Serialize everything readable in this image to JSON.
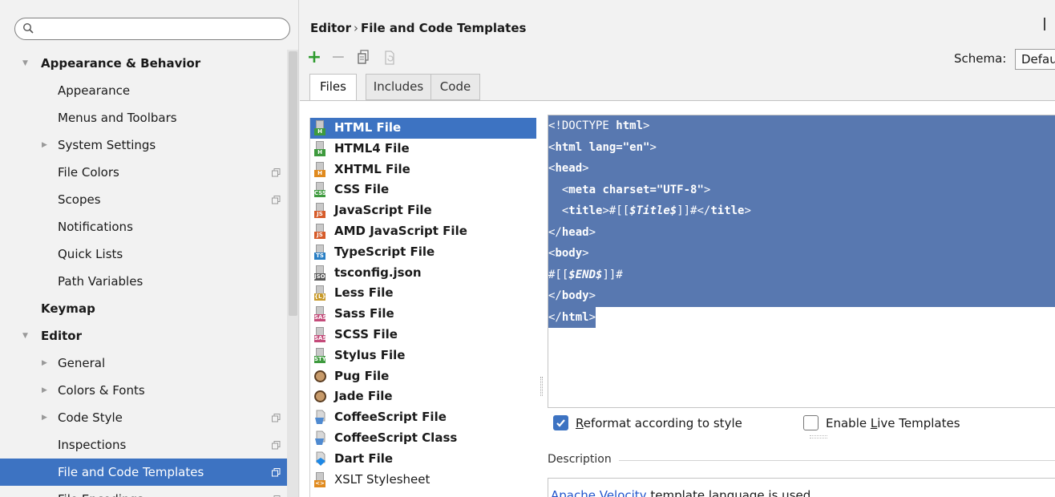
{
  "search": {
    "placeholder": ""
  },
  "tree": [
    {
      "label": "Appearance & Behavior",
      "level": 0,
      "expanded": true
    },
    {
      "label": "Appearance",
      "level": 1
    },
    {
      "label": "Menus and Toolbars",
      "level": 1
    },
    {
      "label": "System Settings",
      "level": 1,
      "collapsed": true
    },
    {
      "label": "File Colors",
      "level": 1,
      "copy": true
    },
    {
      "label": "Scopes",
      "level": 1,
      "copy": true
    },
    {
      "label": "Notifications",
      "level": 1
    },
    {
      "label": "Quick Lists",
      "level": 1
    },
    {
      "label": "Path Variables",
      "level": 1
    },
    {
      "label": "Keymap",
      "level": 0
    },
    {
      "label": "Editor",
      "level": 0,
      "expanded": true
    },
    {
      "label": "General",
      "level": 1,
      "collapsed": true
    },
    {
      "label": "Colors & Fonts",
      "level": 1,
      "collapsed": true
    },
    {
      "label": "Code Style",
      "level": 1,
      "collapsed": true,
      "copy": true
    },
    {
      "label": "Inspections",
      "level": 1,
      "copy": true
    },
    {
      "label": "File and Code Templates",
      "level": 1,
      "copy": true,
      "selected": true
    },
    {
      "label": "File Encodings",
      "level": 1,
      "copy": true
    }
  ],
  "header": {
    "crumb_parent": "Editor",
    "crumb_sep": "›",
    "crumb_current": "File and Code Templates"
  },
  "toolbar": {
    "add": "+",
    "remove": "−"
  },
  "schema": {
    "label": "Schema:",
    "value": "Defau"
  },
  "tabs": [
    "Files",
    "Includes",
    "Code"
  ],
  "templates": [
    {
      "name": "HTML File",
      "tag": "H",
      "color": "#3e9a3e",
      "selected": true
    },
    {
      "name": "HTML4 File",
      "tag": "H",
      "color": "#3e9a3e"
    },
    {
      "name": "XHTML File",
      "tag": "H",
      "color": "#e08a1e"
    },
    {
      "name": "CSS File",
      "tag": "CSS",
      "color": "#3e9a3e"
    },
    {
      "name": "JavaScript File",
      "tag": "JS",
      "color": "#d65c2a"
    },
    {
      "name": "AMD JavaScript File",
      "tag": "JS",
      "color": "#d65c2a"
    },
    {
      "name": "TypeScript File",
      "tag": "TS",
      "color": "#2a7fc4"
    },
    {
      "name": "tsconfig.json",
      "tag": "JSON",
      "color": "#555555"
    },
    {
      "name": "Less File",
      "tag": "{L}",
      "color": "#c89a2a"
    },
    {
      "name": "Sass File",
      "tag": "SASS",
      "color": "#c44b7a"
    },
    {
      "name": "SCSS File",
      "tag": "SASS",
      "color": "#c44b7a"
    },
    {
      "name": "Stylus File",
      "tag": "STYL",
      "color": "#3e9a3e"
    },
    {
      "name": "Pug File",
      "icon": "pug",
      "color": "#c79a6a"
    },
    {
      "name": "Jade File",
      "icon": "pug",
      "color": "#c79a6a"
    },
    {
      "name": "CoffeeScript File",
      "icon": "coffee",
      "color": "#4f8ad0"
    },
    {
      "name": "CoffeeScript Class",
      "icon": "coffee",
      "color": "#4f8ad0"
    },
    {
      "name": "Dart File",
      "icon": "dart",
      "color": "#1e88e5"
    },
    {
      "name": "XSLT Stylesheet",
      "tag": "<>",
      "color": "#e08a1e",
      "plain": true
    }
  ],
  "editor": {
    "l1": "<!DOCTYPE ",
    "l1b": "html",
    "l1c": ">",
    "l2": "<",
    "l2b": "html lang=\"en\"",
    "l2c": ">",
    "l3": "<",
    "l3b": "head",
    "l3c": ">",
    "l4": "  <",
    "l4b": "meta charset=\"UTF-8\"",
    "l4c": ">",
    "l5": "  <",
    "l5b": "title",
    "l5c": ">#[[",
    "l5d": "$Title$",
    "l5e": "]]#</",
    "l5f": "title",
    "l5g": ">",
    "l6": "</",
    "l6b": "head",
    "l6c": ">",
    "l7": "<",
    "l7b": "body",
    "l7c": ">",
    "l8": "#[[",
    "l8b": "$END$",
    "l8c": "]]#",
    "l9": "</",
    "l9b": "body",
    "l9c": ">",
    "l10": "</",
    "l10b": "html",
    "l10c": ">"
  },
  "options": {
    "reformat_pre": "",
    "reformat_u": "R",
    "reformat_post": "eformat according to style",
    "reformat_checked": true,
    "live_pre": "Enable ",
    "live_u": "L",
    "live_post": "ive Templates",
    "live_checked": false
  },
  "description": {
    "label": "Description",
    "link": "Apache Velocity",
    "text": " template language is used"
  },
  "colors": {
    "selection": "#3d73c2",
    "code_highlight": "#5878b0"
  }
}
